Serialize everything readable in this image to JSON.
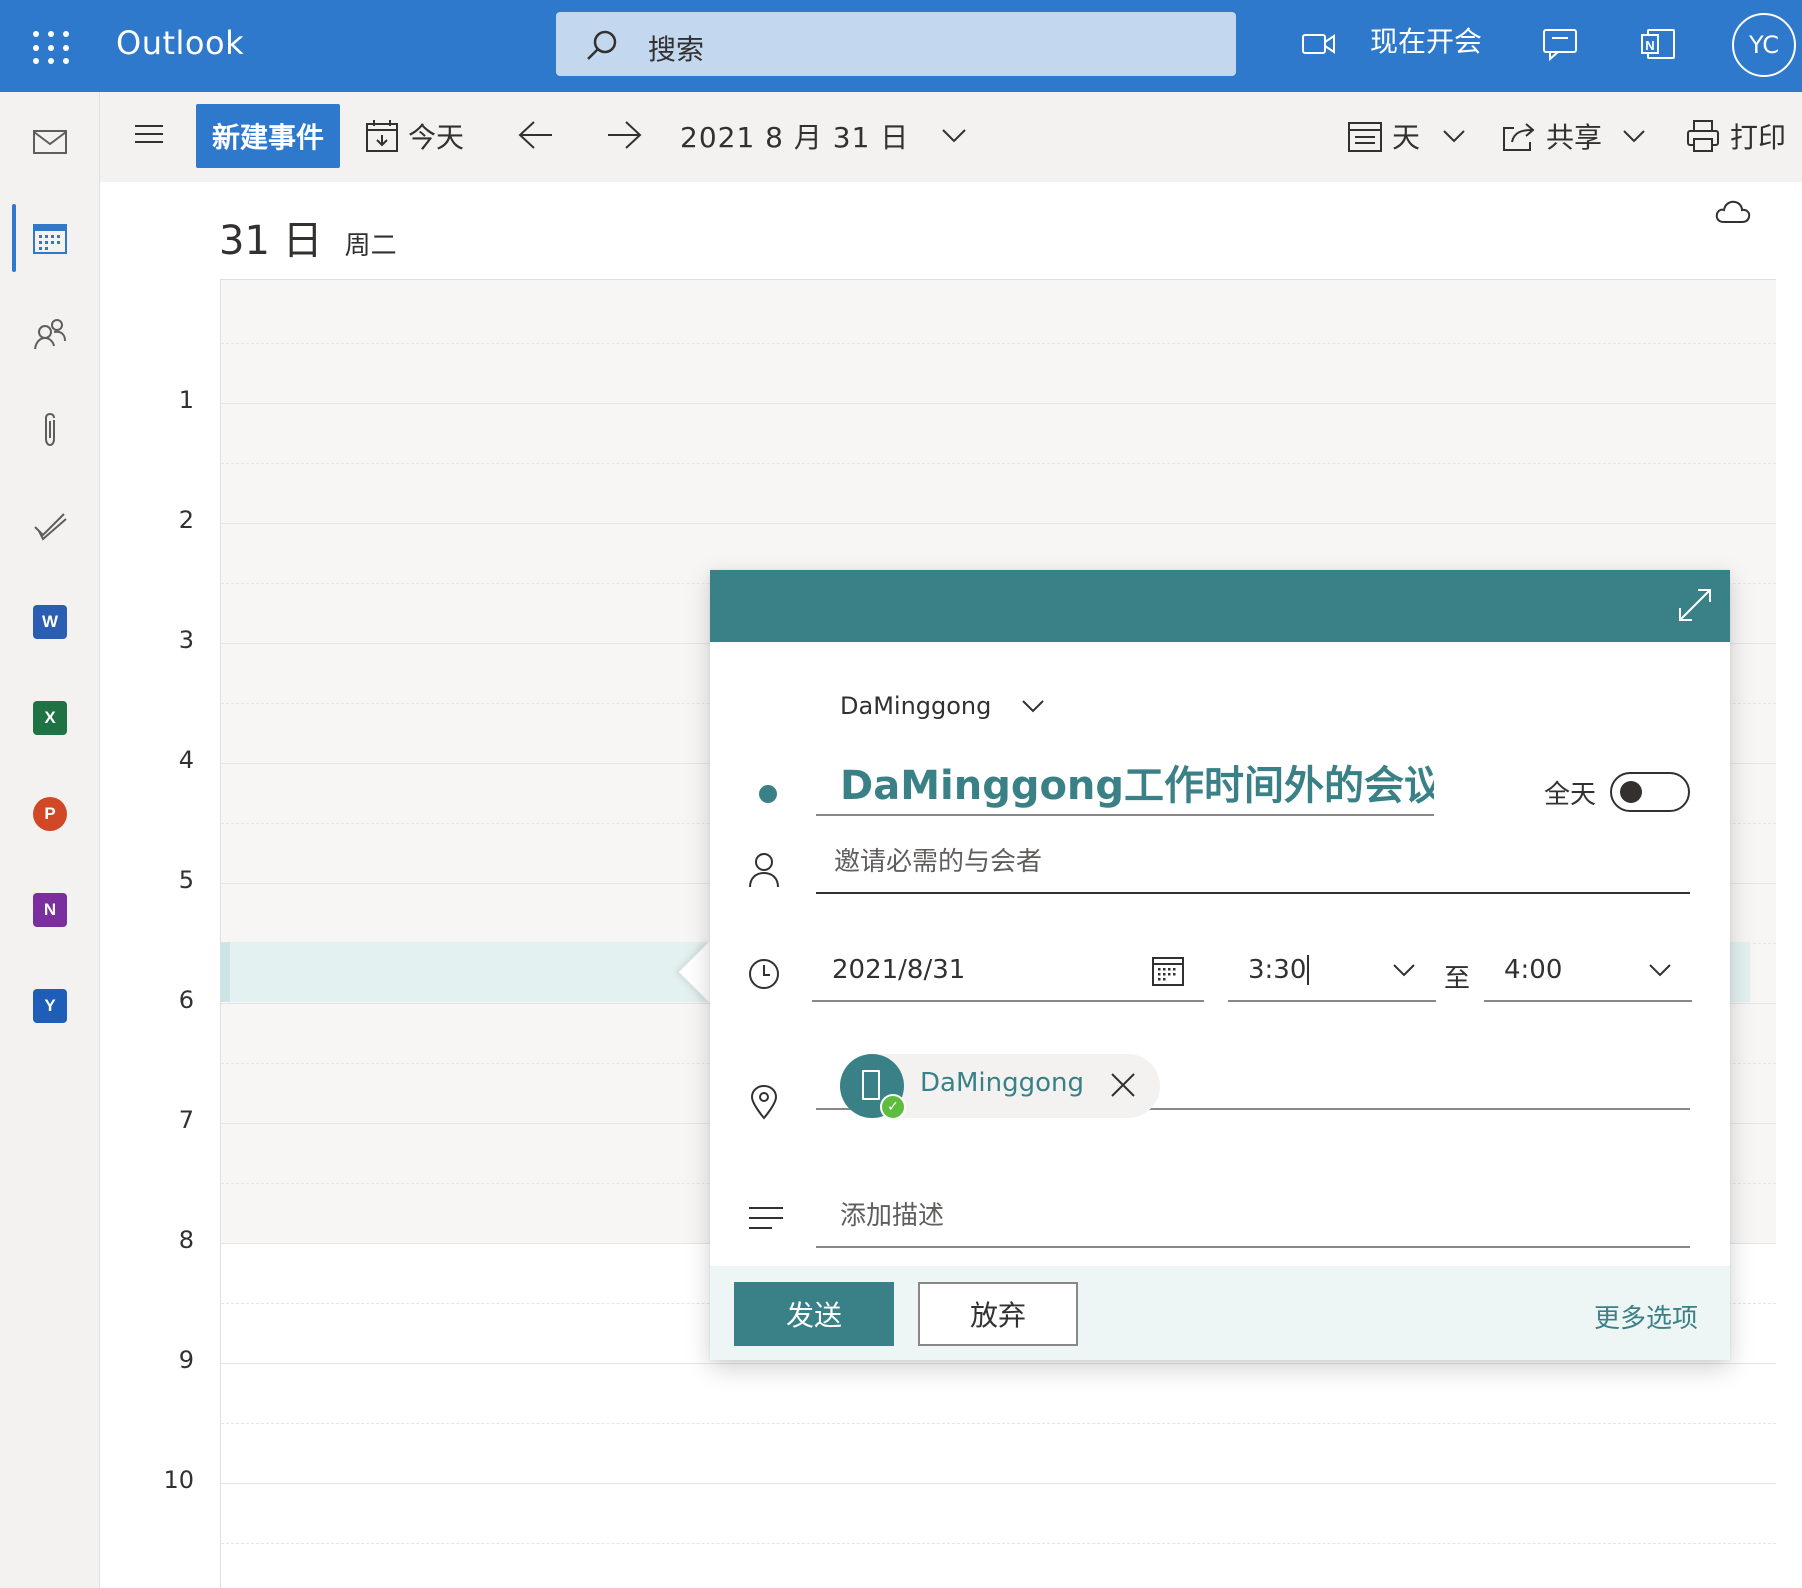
{
  "app": {
    "name": "Outlook",
    "avatar_initials": "YC"
  },
  "search": {
    "placeholder": "搜索"
  },
  "header_actions": {
    "meet_now": "现在开会"
  },
  "toolbar": {
    "new_event": "新建事件",
    "today": "今天",
    "date": "2021 8 月 31 日",
    "view": "天",
    "share": "共享",
    "print": "打印"
  },
  "day": {
    "number": "31 日",
    "weekday": "周二"
  },
  "hours": [
    "1",
    "2",
    "3",
    "4",
    "5",
    "6",
    "7",
    "8",
    "9",
    "10"
  ],
  "event_form": {
    "calendar": "DaMinggong",
    "title": "DaMinggong工作时间外的会议",
    "all_day_label": "全天",
    "all_day": false,
    "attendees_placeholder": "邀请必需的与会者",
    "date": "2021/8/31",
    "start_time": "3:30",
    "to_label": "至",
    "end_time": "4:00",
    "location": "DaMinggong",
    "description_placeholder": "添加描述",
    "send": "发送",
    "discard": "放弃",
    "more_options": "更多选项"
  },
  "colors": {
    "brand_blue": "#2f79cd",
    "calendar_teal": "#3a8187",
    "available_green": "#5ebd3e"
  },
  "icons": [
    "waffle-icon",
    "search-icon",
    "video-icon",
    "chat-icon",
    "onenote-icon",
    "mail-icon",
    "calendar-icon",
    "people-icon",
    "attachment-icon",
    "todo-icon",
    "word-icon",
    "excel-icon",
    "powerpoint-icon",
    "onenote-app-icon",
    "yammer-icon",
    "hamburger-icon",
    "today-icon",
    "arrow-left-icon",
    "arrow-right-icon",
    "chevron-down-icon",
    "view-icon",
    "share-icon",
    "print-icon",
    "weather-icon",
    "expand-icon",
    "person-icon",
    "clock-icon",
    "location-icon",
    "description-icon",
    "room-icon",
    "close-icon"
  ]
}
